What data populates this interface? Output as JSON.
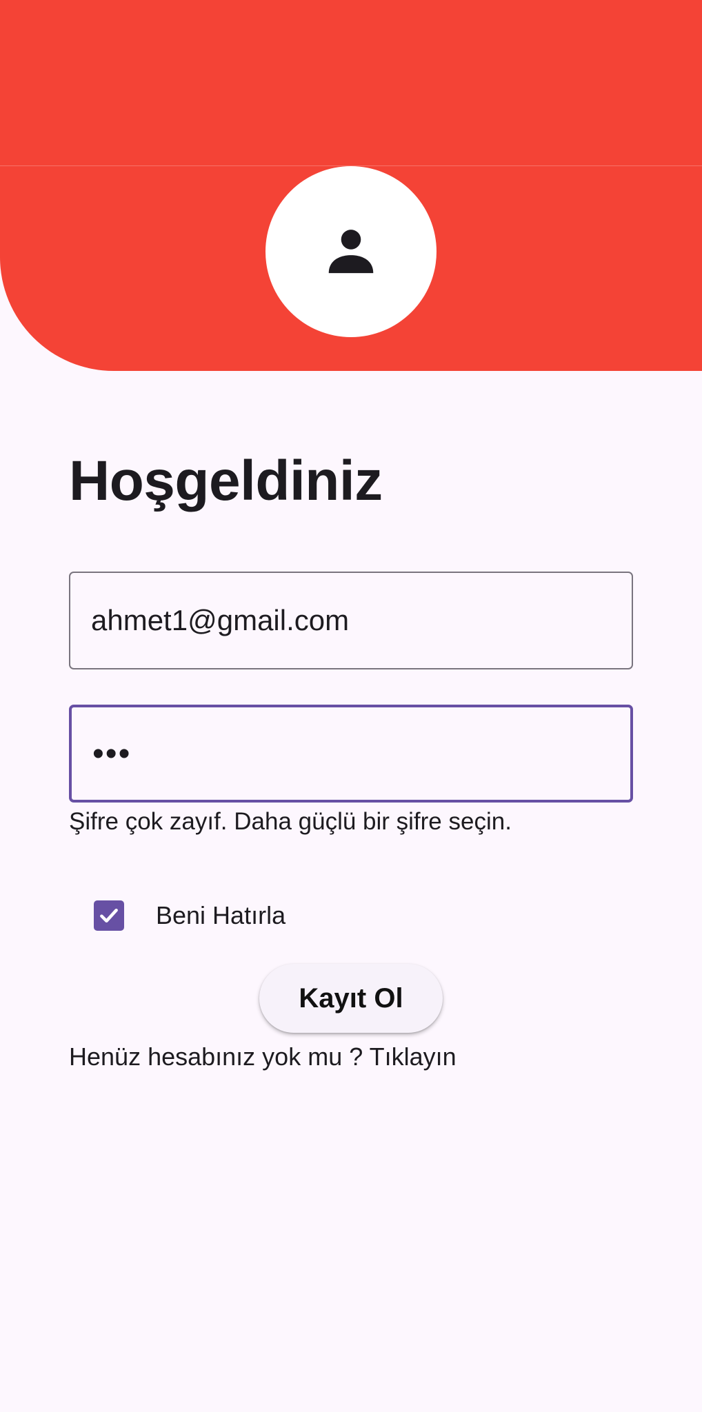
{
  "header": {
    "color": "#f44336",
    "avatar_icon": "person-icon"
  },
  "main": {
    "title": "Hoşgeldiniz",
    "email": {
      "value": "ahmet1@gmail.com"
    },
    "password": {
      "value": "•••"
    },
    "password_helper": "Şifre çok zayıf. Daha güçlü bir şifre seçin.",
    "remember_me": {
      "label": "Beni Hatırla",
      "checked": true
    },
    "register_button": "Kayıt Ol",
    "signup_prompt": "Henüz hesabınız yok mu ? Tıklayın"
  },
  "colors": {
    "background": "#fdf7fe",
    "accent": "#6750a4",
    "text": "#1d1b20"
  }
}
